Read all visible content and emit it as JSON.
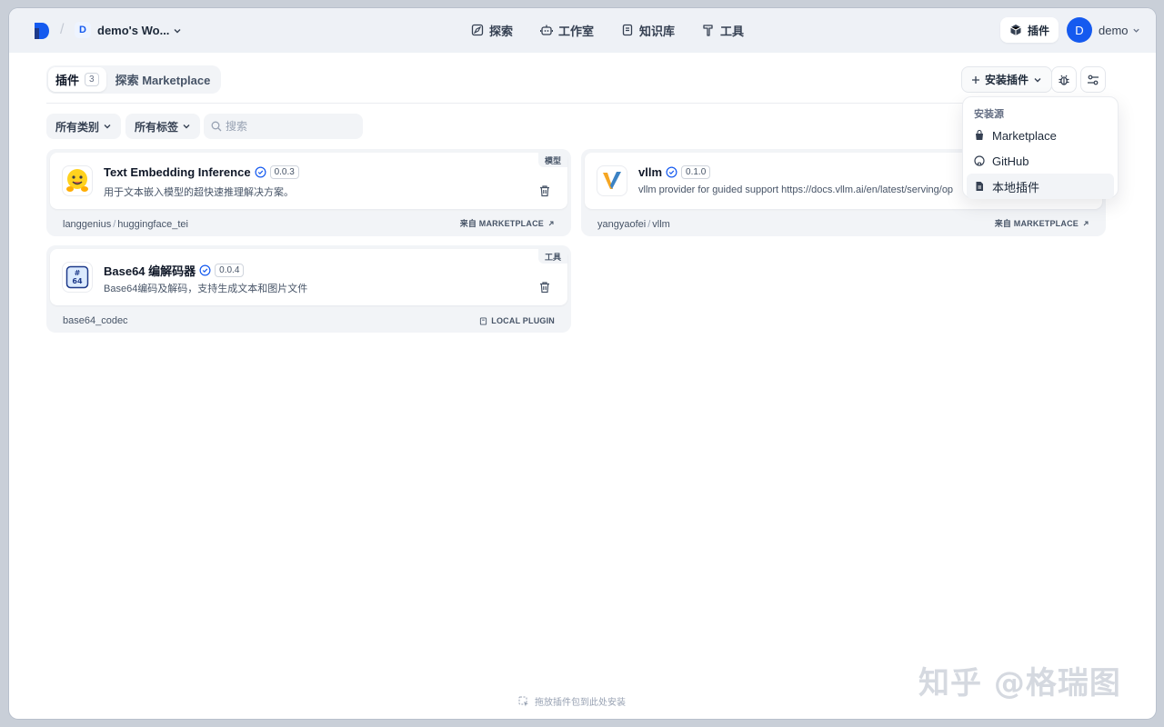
{
  "header": {
    "workspace_initial": "D",
    "workspace_name": "demo's Wo...",
    "nav": [
      {
        "label": "探索",
        "icon": "compass-icon"
      },
      {
        "label": "工作室",
        "icon": "robot-icon"
      },
      {
        "label": "知识库",
        "icon": "book-icon"
      },
      {
        "label": "工具",
        "icon": "hammer-icon"
      }
    ],
    "plugin_button": "插件",
    "user_initial": "D",
    "user_name": "demo"
  },
  "tabs": {
    "plugins_label": "插件",
    "plugins_count": "3",
    "marketplace_label": "探索 Marketplace"
  },
  "toolbar": {
    "install_label": "安装插件"
  },
  "install_menu": {
    "title": "安装源",
    "items": [
      "Marketplace",
      "GitHub",
      "本地插件"
    ]
  },
  "filters": {
    "category": "所有类别",
    "tags": "所有标签",
    "search_placeholder": "搜索"
  },
  "plugins": [
    {
      "title": "Text Embedding Inference",
      "version": "0.0.3",
      "description": "用于文本嵌入模型的超快速推理解决方案。",
      "tag": "模型",
      "org": "langgenius",
      "name": "huggingface_tei",
      "source": "来自 MARKETPLACE"
    },
    {
      "title": "vllm",
      "version": "0.1.0",
      "description": "vllm provider for guided support https://docs.vllm.ai/en/latest/serving/op",
      "tag": "",
      "org": "yangyaofei",
      "name": "vllm",
      "source": "来自 MARKETPLACE"
    },
    {
      "title": "Base64 编解码器",
      "version": "0.0.4",
      "description": "Base64编码及解码，支持生成文本和图片文件",
      "tag": "工具",
      "org": "",
      "name": "base64_codec",
      "source": "LOCAL PLUGIN"
    }
  ],
  "drop_hint": "拖放插件包到此处安装",
  "watermark": "知乎 @格瑞图"
}
